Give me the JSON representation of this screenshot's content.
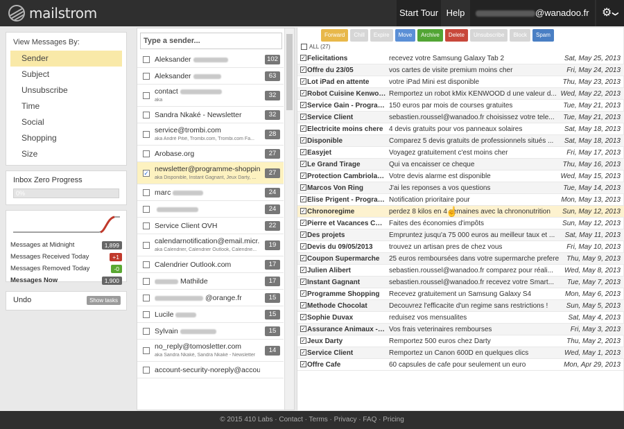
{
  "header": {
    "brand": "mailstrom",
    "start_tour": "Start Tour",
    "help": "Help",
    "account_domain": "@wanadoo.fr",
    "account_chevron": "❯",
    "gear": "⚙"
  },
  "viewby": {
    "title": "View Messages By:",
    "items": [
      "Sender",
      "Subject",
      "Unsubscribe",
      "Time",
      "Social",
      "Shopping",
      "Size"
    ],
    "active": 0
  },
  "progress": {
    "title": "Inbox Zero Progress",
    "value": "0%",
    "fraction": 0
  },
  "stats": [
    {
      "label": "Messages at Midnight",
      "value": "1,899",
      "color": "#666666"
    },
    {
      "label": "Messages Received Today",
      "value": "+1",
      "color": "#c0392b"
    },
    {
      "label": "Messages Removed Today",
      "value": "-0",
      "color": "#5aa832"
    },
    {
      "label": "Messages Now",
      "value": "1,900",
      "color": "#666666"
    }
  ],
  "undo": {
    "label": "Undo",
    "button": "Show tasks"
  },
  "search": {
    "placeholder": "Type a sender..."
  },
  "senders": [
    {
      "name": "Aleksander",
      "aka": "",
      "count": "102"
    },
    {
      "name": "Aleksander",
      "aka": "",
      "count": "63"
    },
    {
      "name": "contact",
      "aka": "aka",
      "count": "32"
    },
    {
      "name": "Sandra Nkaké - Newsletter",
      "aka": "",
      "count": "32"
    },
    {
      "name": "service@trombi.com",
      "aka": "aka André Pitié, Trombi.com, Trombi.com Fa...",
      "count": "28"
    },
    {
      "name": "Arobase.org",
      "aka": "",
      "count": "27"
    },
    {
      "name": "newsletter@programme-shoppin...",
      "aka": "aka Disponible, Instant Gagnant, Jeux Darty, ...",
      "count": "27"
    },
    {
      "name": "marc",
      "aka": "",
      "count": "24"
    },
    {
      "name": "",
      "aka": "",
      "count": "24"
    },
    {
      "name": "Service Client OVH",
      "aka": "",
      "count": "22"
    },
    {
      "name": "calendarnotification@email.micr...",
      "aka": "aka Calendrier, Calendrier Outlook, Calendrie...",
      "count": "19"
    },
    {
      "name": "Calendrier Outlook.com",
      "aka": "",
      "count": "17"
    },
    {
      "name": "Mathilde",
      "aka": "",
      "count": "17"
    },
    {
      "name": "@orange.fr",
      "aka": "",
      "count": "15"
    },
    {
      "name": "Lucile",
      "aka": "",
      "count": "15"
    },
    {
      "name": "Sylvain",
      "aka": "",
      "count": "15"
    },
    {
      "name": "no_reply@tomosletter.com",
      "aka": "aka Sandra Nkaké, Sandra Nkaké - Newsletter",
      "count": "14"
    },
    {
      "name": "account-security-noreply@accou...",
      "aka": "",
      "count": ""
    }
  ],
  "toolbar": [
    "Forward",
    "Chill",
    "Expire",
    "Move",
    "Archive",
    "Delete",
    "Unsubscribe",
    "Block",
    "Spam"
  ],
  "toolbar_colors": [
    "#e8b84a",
    "#d6d6d6",
    "#d6d6d6",
    "#5b8fd6",
    "#52a535",
    "#c8483b",
    "#d6d6d6",
    "#d6d6d6",
    "#4a7fc4"
  ],
  "all_label": "ALL (27)",
  "emails": [
    {
      "from": "Felicitations",
      "subject": "recevez votre Samsung Galaxy Tab 2",
      "date": "Sat, May 25, 2013"
    },
    {
      "from": "Offre du 23/05",
      "subject": "vos cartes de visite premium moins cher",
      "date": "Fri, May 24, 2013"
    },
    {
      "from": "Lot iPad en attente",
      "subject": "votre iPad Mini est disponible",
      "date": "Thu, May 23, 2013"
    },
    {
      "from": "Robot Cuisine Kenwoo...",
      "subject": "Remportez un robot kMix KENWOOD d une valeur d...",
      "date": "Wed, May 22, 2013"
    },
    {
      "from": "Service Gain - Program...",
      "subject": "150 euros par mois de courses gratuites",
      "date": "Tue, May 21, 2013"
    },
    {
      "from": "Service Client",
      "subject": "sebastien.roussel@wanadoo.fr choisissez votre tele...",
      "date": "Tue, May 21, 2013"
    },
    {
      "from": "Electricite moins chere",
      "subject": "4 devis gratuits pour vos panneaux solaires",
      "date": "Sat, May 18, 2013"
    },
    {
      "from": "Disponible",
      "subject": "Comparez 5 devis gratuits de professionnels situés ...",
      "date": "Sat, May 18, 2013"
    },
    {
      "from": "Easyjet",
      "subject": "Voyagez gratuitement c'est moins cher",
      "date": "Fri, May 17, 2013"
    },
    {
      "from": "Le Grand Tirage",
      "subject": "Qui va encaisser ce cheque",
      "date": "Thu, May 16, 2013"
    },
    {
      "from": "Protection Cambriolag...",
      "subject": "Votre devis alarme est disponible",
      "date": "Wed, May 15, 2013"
    },
    {
      "from": "Marcos Von Ring",
      "subject": "J'ai les reponses a vos questions",
      "date": "Tue, May 14, 2013"
    },
    {
      "from": "Elise Prigent - Program...",
      "subject": "Notification prioritaire pour",
      "date": "Mon, May 13, 2013"
    },
    {
      "from": "Chronoregime",
      "subject": "perdez 8 kilos en 4 semaines avec la chrononutrition",
      "date": "Sun, May 12, 2013"
    },
    {
      "from": "Pierre et Vacances Cons...",
      "subject": "Faites des économies d'impôts",
      "date": "Sun, May 12, 2013"
    },
    {
      "from": "Des projets",
      "subject": "Empruntez jusqu'a 75 000 euros au meilleur taux et ...",
      "date": "Sat, May 11, 2013"
    },
    {
      "from": "Devis du 09/05/2013",
      "subject": "trouvez un artisan pres de chez vous",
      "date": "Fri, May 10, 2013"
    },
    {
      "from": "Coupon Supermarche",
      "subject": "25 euros remboursées dans votre supermarche prefere",
      "date": "Thu, May 9, 2013"
    },
    {
      "from": "Julien Alibert",
      "subject": "sebastien.roussel@wanadoo.fr comparez pour réali...",
      "date": "Wed, May 8, 2013"
    },
    {
      "from": "Instant Gagnant",
      "subject": "sebastien.roussel@wanadoo.fr recevez votre Smart...",
      "date": "Tue, May 7, 2013"
    },
    {
      "from": "Programme Shopping",
      "subject": "Recevez gratuitement un Samsung Galaxy S4",
      "date": "Mon, May 6, 2013"
    },
    {
      "from": "Methode Chocolat",
      "subject": "Decouvrez l'efficacite d'un regime sans restrictions !",
      "date": "Sun, May 5, 2013"
    },
    {
      "from": "Sophie Duvax",
      "subject": "reduisez vos mensualites",
      "date": "Sat, May 4, 2013"
    },
    {
      "from": "Assurance Animaux - Pr...",
      "subject": "Vos frais veterinaires rembourses",
      "date": "Fri, May 3, 2013"
    },
    {
      "from": "Jeux Darty",
      "subject": "Remportez 500 euros chez Darty",
      "date": "Thu, May 2, 2013"
    },
    {
      "from": "Service Client",
      "subject": "Remportez un Canon 600D en quelques clics",
      "date": "Wed, May 1, 2013"
    },
    {
      "from": "Offre Cafe",
      "subject": "60 capsules de cafe pour seulement un euro",
      "date": "Mon, Apr 29, 2013"
    }
  ],
  "footer": "© 2015 410 Labs · Contact · Terms · Privacy · FAQ · Pricing"
}
